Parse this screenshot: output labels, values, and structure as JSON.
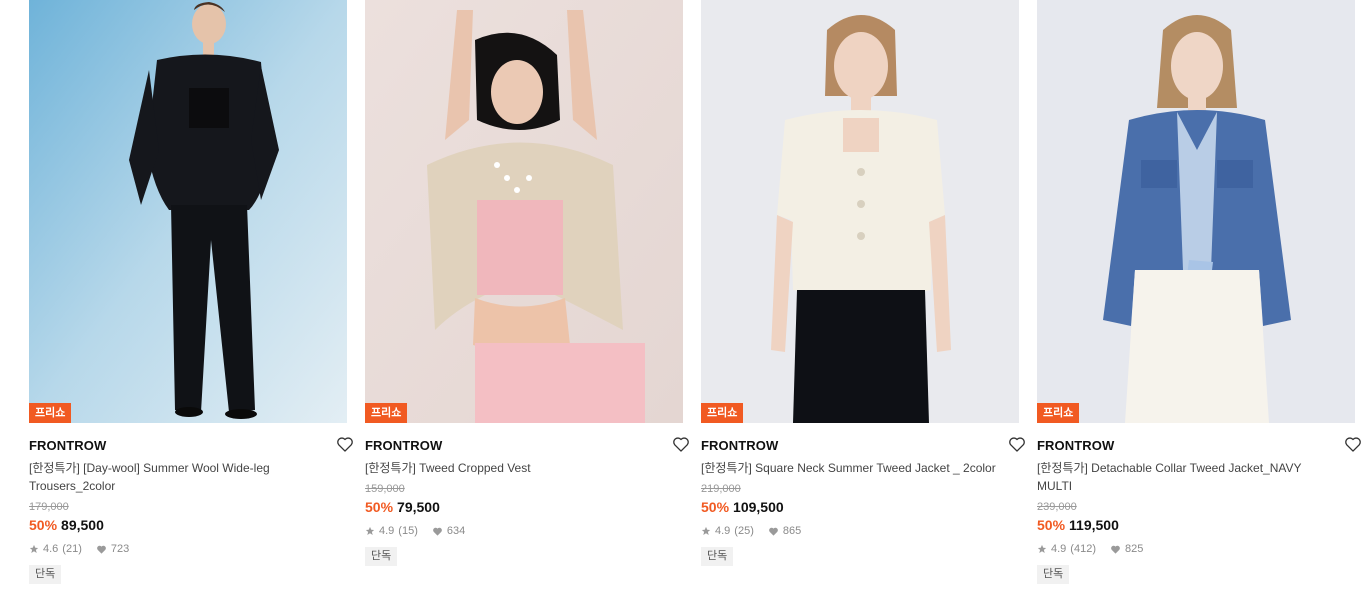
{
  "products": [
    {
      "badge": "프리쇼",
      "brand": "FRONTROW",
      "title": "[한정특가] [Day-wool] Summer Wool Wide-leg Trousers_2color",
      "original_price": "179,000",
      "discount": "50%",
      "price": "89,500",
      "rating": "4.6",
      "review_count": "(21)",
      "likes": "723",
      "tag": "단독",
      "image": "model-black-suit"
    },
    {
      "badge": "프리쇼",
      "brand": "FRONTROW",
      "title": "[한정특가] Tweed Cropped Vest",
      "original_price": "159,000",
      "discount": "50%",
      "price": "79,500",
      "rating": "4.9",
      "review_count": "(15)",
      "likes": "634",
      "tag": "단독",
      "image": "model-pink-tweed"
    },
    {
      "badge": "프리쇼",
      "brand": "FRONTROW",
      "title": "[한정특가] Square Neck Summer Tweed Jacket _ 2color",
      "original_price": "219,000",
      "discount": "50%",
      "price": "109,500",
      "rating": "4.9",
      "review_count": "(25)",
      "likes": "865",
      "tag": "단독",
      "image": "model-ivory-jacket"
    },
    {
      "badge": "프리쇼",
      "brand": "FRONTROW",
      "title": "[한정특가] Detachable Collar Tweed Jacket_NAVY MULTI",
      "original_price": "239,000",
      "discount": "50%",
      "price": "119,500",
      "rating": "4.9",
      "review_count": "(412)",
      "likes": "825",
      "tag": "단독",
      "image": "model-blue-tweed"
    }
  ],
  "colors": {
    "accent": "#f15a22",
    "meta_gray": "#8a8a8a",
    "tag_bg": "#f1f1f1"
  },
  "icons": {
    "wishlist": "heart-outline-icon",
    "rating": "star-icon",
    "likes": "heart-filled-icon"
  }
}
